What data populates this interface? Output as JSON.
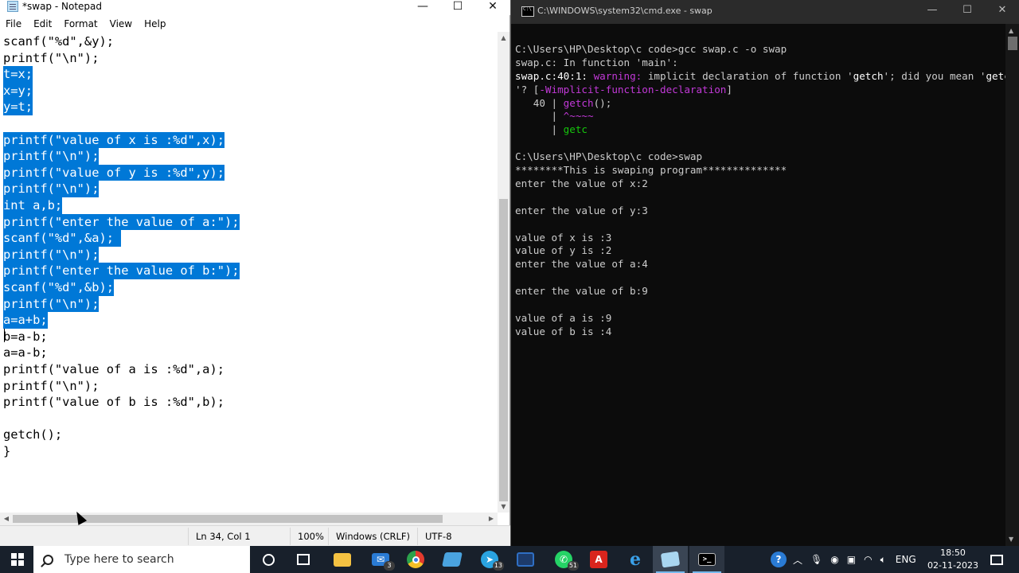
{
  "notepad": {
    "title": "*swap - Notepad",
    "window_buttons": {
      "minimize": "—",
      "maximize": "☐",
      "close": "✕"
    },
    "menu": [
      "File",
      "Edit",
      "Format",
      "View",
      "Help"
    ],
    "lines": [
      {
        "text": "scanf(\"%d\",&y);",
        "selected": false
      },
      {
        "text": "printf(\"\\n\");",
        "selected": false
      },
      {
        "text": "t=x;",
        "selected": true
      },
      {
        "text": "x=y;",
        "selected": true
      },
      {
        "text": "y=t;",
        "selected": true
      },
      {
        "text": "",
        "selected": false
      },
      {
        "text": "printf(\"value of x is :%d\",x);",
        "selected": true
      },
      {
        "text": "printf(\"\\n\");",
        "selected": true
      },
      {
        "text": "printf(\"value of y is :%d\",y);",
        "selected": true
      },
      {
        "text": "printf(\"\\n\");",
        "selected": true
      },
      {
        "text": "int a,b;",
        "selected": true
      },
      {
        "text": "printf(\"enter the value of a:\");",
        "selected": true
      },
      {
        "text": "scanf(\"%d\",&a); ",
        "selected": true
      },
      {
        "text": "printf(\"\\n\");",
        "selected": true
      },
      {
        "text": "printf(\"enter the value of b:\");",
        "selected": true
      },
      {
        "text": "scanf(\"%d\",&b);",
        "selected": true
      },
      {
        "text": "printf(\"\\n\");",
        "selected": true
      },
      {
        "text": "a=a+b;",
        "selected": true
      },
      {
        "text": "b=a-b;",
        "selected": false
      },
      {
        "text": "a=a-b;",
        "selected": false
      },
      {
        "text": "printf(\"value of a is :%d\",a);",
        "selected": false
      },
      {
        "text": "printf(\"\\n\");",
        "selected": false
      },
      {
        "text": "printf(\"value of b is :%d\",b);",
        "selected": false
      },
      {
        "text": "",
        "selected": false
      },
      {
        "text": "getch();",
        "selected": false
      },
      {
        "text": "}",
        "selected": false
      }
    ],
    "status": {
      "position": "Ln 34, Col 1",
      "zoom": "100%",
      "line_ending": "Windows (CRLF)",
      "encoding": "UTF-8"
    }
  },
  "cmd": {
    "title": "C:\\WINDOWS\\system32\\cmd.exe - swap",
    "window_buttons": {
      "minimize": "—",
      "maximize": "☐",
      "close": "✕"
    },
    "lines": [
      [
        {
          "t": "",
          "c": ""
        }
      ],
      [
        {
          "t": "C:\\Users\\HP\\Desktop\\c code>gcc swap.c -o swap",
          "c": ""
        }
      ],
      [
        {
          "t": "swap.c: In function 'main':",
          "c": ""
        }
      ],
      [
        {
          "t": "swap.c:40:1: ",
          "c": "c-white"
        },
        {
          "t": "warning: ",
          "c": "c-warn"
        },
        {
          "t": "implicit declaration of function '",
          "c": ""
        },
        {
          "t": "getch",
          "c": "c-white"
        },
        {
          "t": "'; did you mean '",
          "c": ""
        },
        {
          "t": "getc",
          "c": "c-white"
        }
      ],
      [
        {
          "t": "'? [",
          "c": ""
        },
        {
          "t": "-Wimplicit-function-declaration",
          "c": "c-warn"
        },
        {
          "t": "]",
          "c": ""
        }
      ],
      [
        {
          "t": "   40 | ",
          "c": ""
        },
        {
          "t": "getch",
          "c": "c-warn"
        },
        {
          "t": "();",
          "c": ""
        }
      ],
      [
        {
          "t": "      | ",
          "c": ""
        },
        {
          "t": "^~~~~",
          "c": "c-warn"
        }
      ],
      [
        {
          "t": "      | ",
          "c": ""
        },
        {
          "t": "getc",
          "c": "c-green"
        }
      ],
      [
        {
          "t": "",
          "c": ""
        }
      ],
      [
        {
          "t": "C:\\Users\\HP\\Desktop\\c code>swap",
          "c": ""
        }
      ],
      [
        {
          "t": "********This is swaping program**************",
          "c": ""
        }
      ],
      [
        {
          "t": "enter the value of x:2",
          "c": ""
        }
      ],
      [
        {
          "t": "",
          "c": ""
        }
      ],
      [
        {
          "t": "enter the value of y:3",
          "c": ""
        }
      ],
      [
        {
          "t": "",
          "c": ""
        }
      ],
      [
        {
          "t": "value of x is :3",
          "c": ""
        }
      ],
      [
        {
          "t": "value of y is :2",
          "c": ""
        }
      ],
      [
        {
          "t": "enter the value of a:4",
          "c": ""
        }
      ],
      [
        {
          "t": "",
          "c": ""
        }
      ],
      [
        {
          "t": "enter the value of b:9",
          "c": ""
        }
      ],
      [
        {
          "t": "",
          "c": ""
        }
      ],
      [
        {
          "t": "value of a is :9",
          "c": ""
        }
      ],
      [
        {
          "t": "value of b is :4",
          "c": ""
        }
      ]
    ]
  },
  "taskbar": {
    "search_placeholder": "Type here to search",
    "mail_badge": "3",
    "whatsapp_badge": "51",
    "telegram_badge": "13",
    "language": "ENG",
    "time": "18:50",
    "date": "02-11-2023",
    "colors": {
      "bar": "#18202b",
      "accent": "#76b9ed"
    }
  }
}
